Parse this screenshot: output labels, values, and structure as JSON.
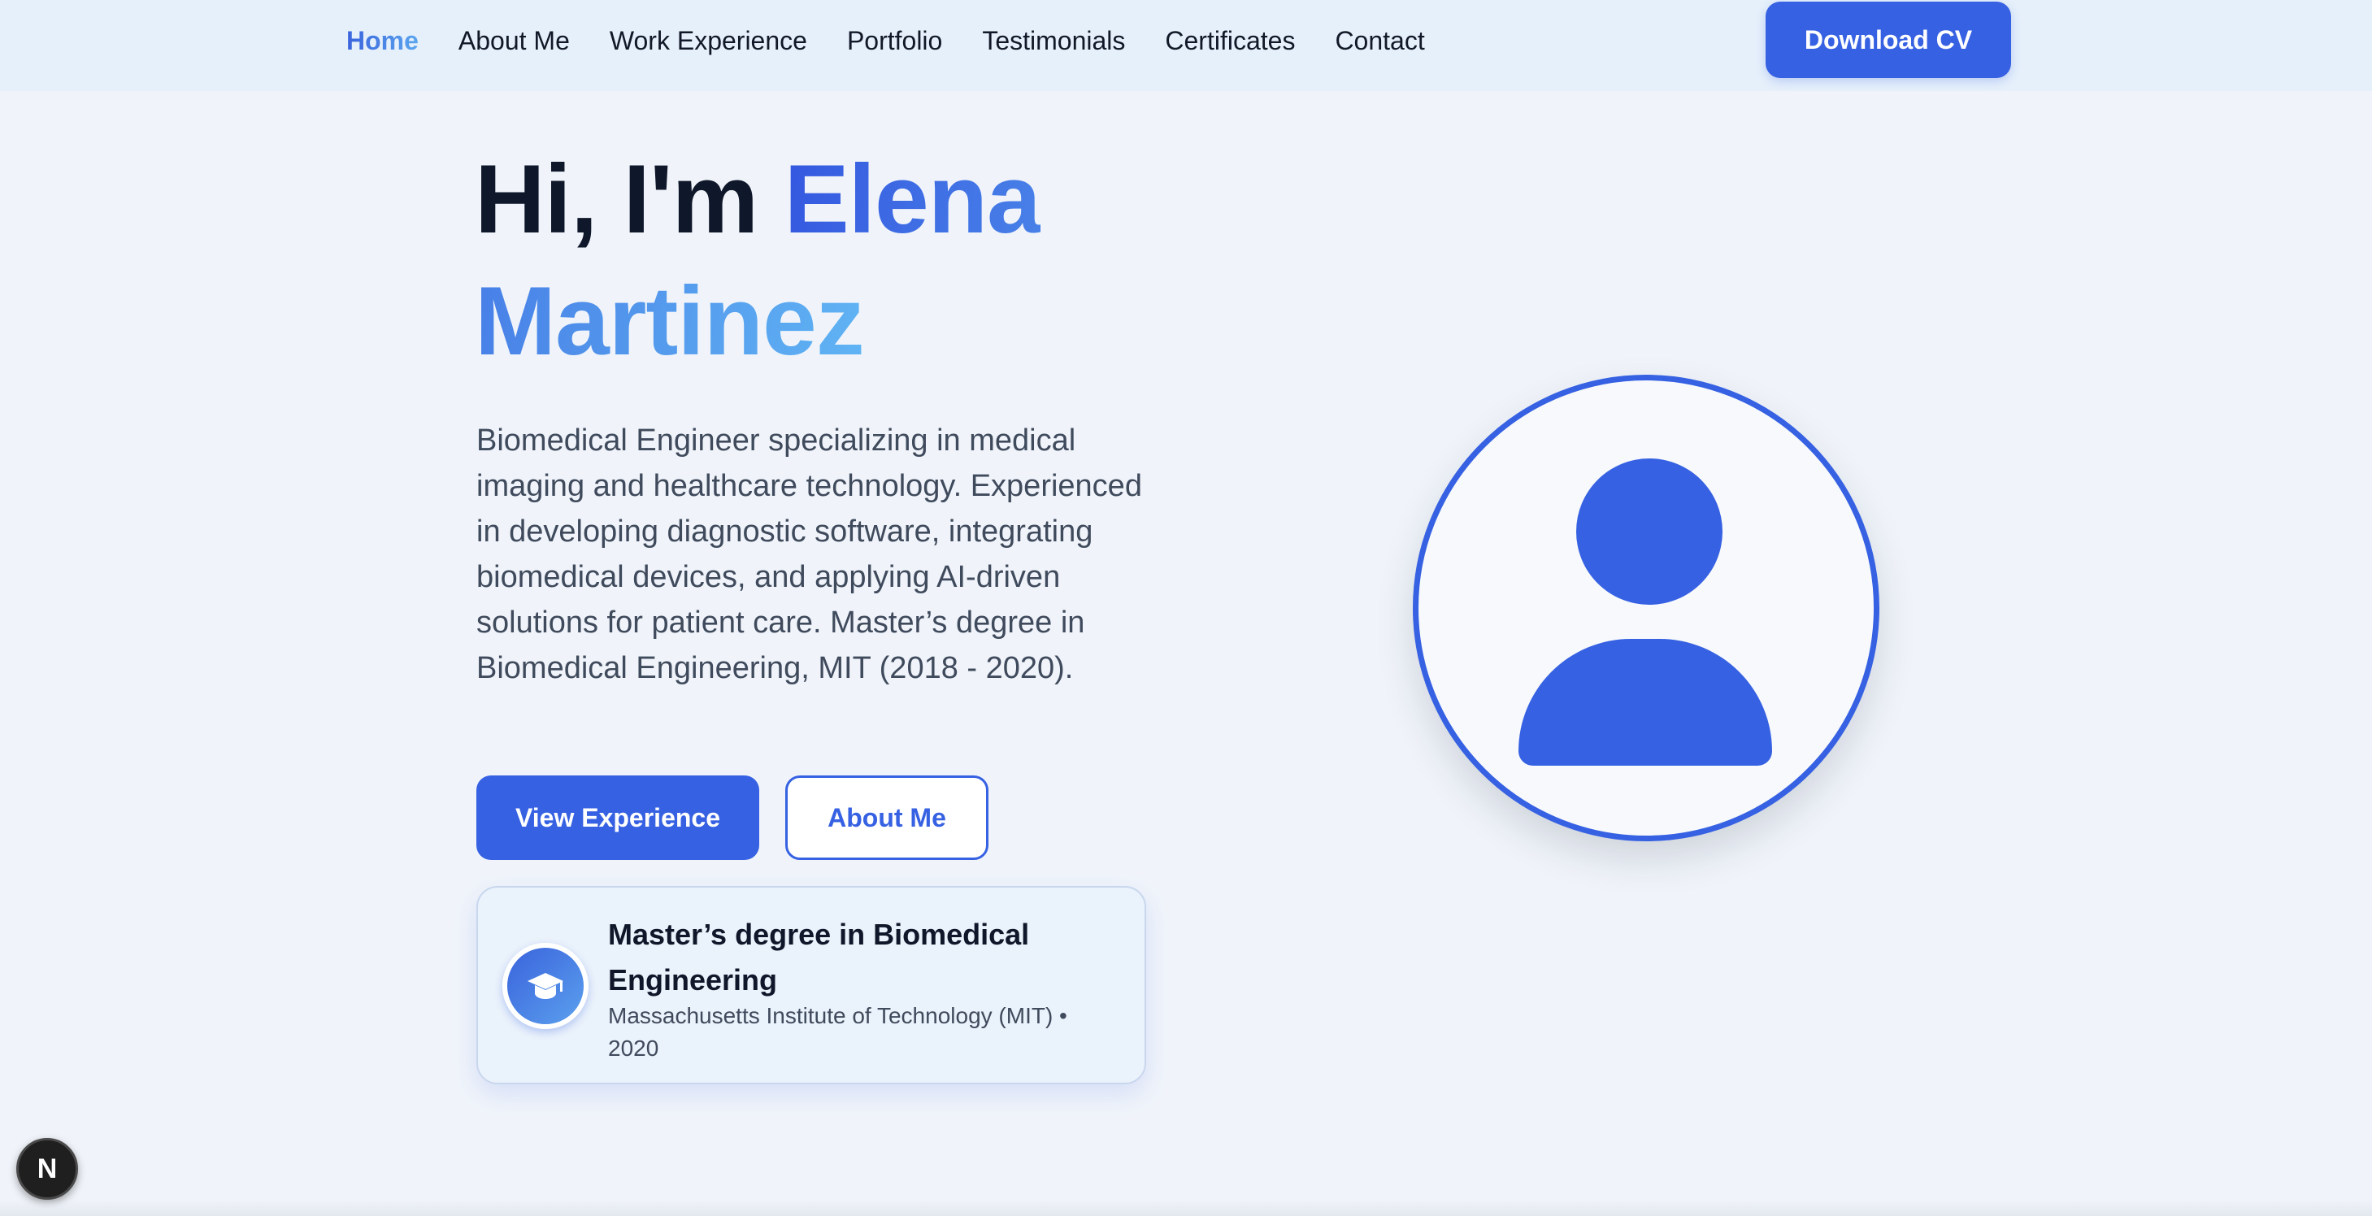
{
  "nav": {
    "links": [
      {
        "label": "Home",
        "active": true
      },
      {
        "label": "About Me",
        "active": false
      },
      {
        "label": "Work Experience",
        "active": false
      },
      {
        "label": "Portfolio",
        "active": false
      },
      {
        "label": "Testimonials",
        "active": false
      },
      {
        "label": "Certificates",
        "active": false
      },
      {
        "label": "Contact",
        "active": false
      }
    ],
    "download_label": "Download CV"
  },
  "hero": {
    "greeting": "Hi, I'm ",
    "name": "Elena Martinez",
    "bio": "Biomedical Engineer specializing in medical imaging and healthcare technology. Experienced in developing diagnostic software, integrating biomedical devices, and applying AI-driven solutions for patient care. Master’s degree in Biomedical Engineering, MIT (2018 - 2020).",
    "primary_button": "View Experience",
    "secondary_button": "About Me"
  },
  "education": {
    "icon": "graduation-cap-icon",
    "degree": "Master’s degree in Biomedical Engineering",
    "school": "Massachusetts Institute of Technology (MIT) • 2020"
  },
  "avatar": {
    "icon": "user-avatar-icon"
  },
  "dev_badge": {
    "label": "N",
    "icon": "nextjs-logo-icon"
  },
  "colors": {
    "accent": "#3661e2",
    "gradient_start": "#3457e0",
    "gradient_end": "#60b4f4",
    "page_background": "#f0f4fa",
    "nav_background": "#e6f0fb"
  }
}
